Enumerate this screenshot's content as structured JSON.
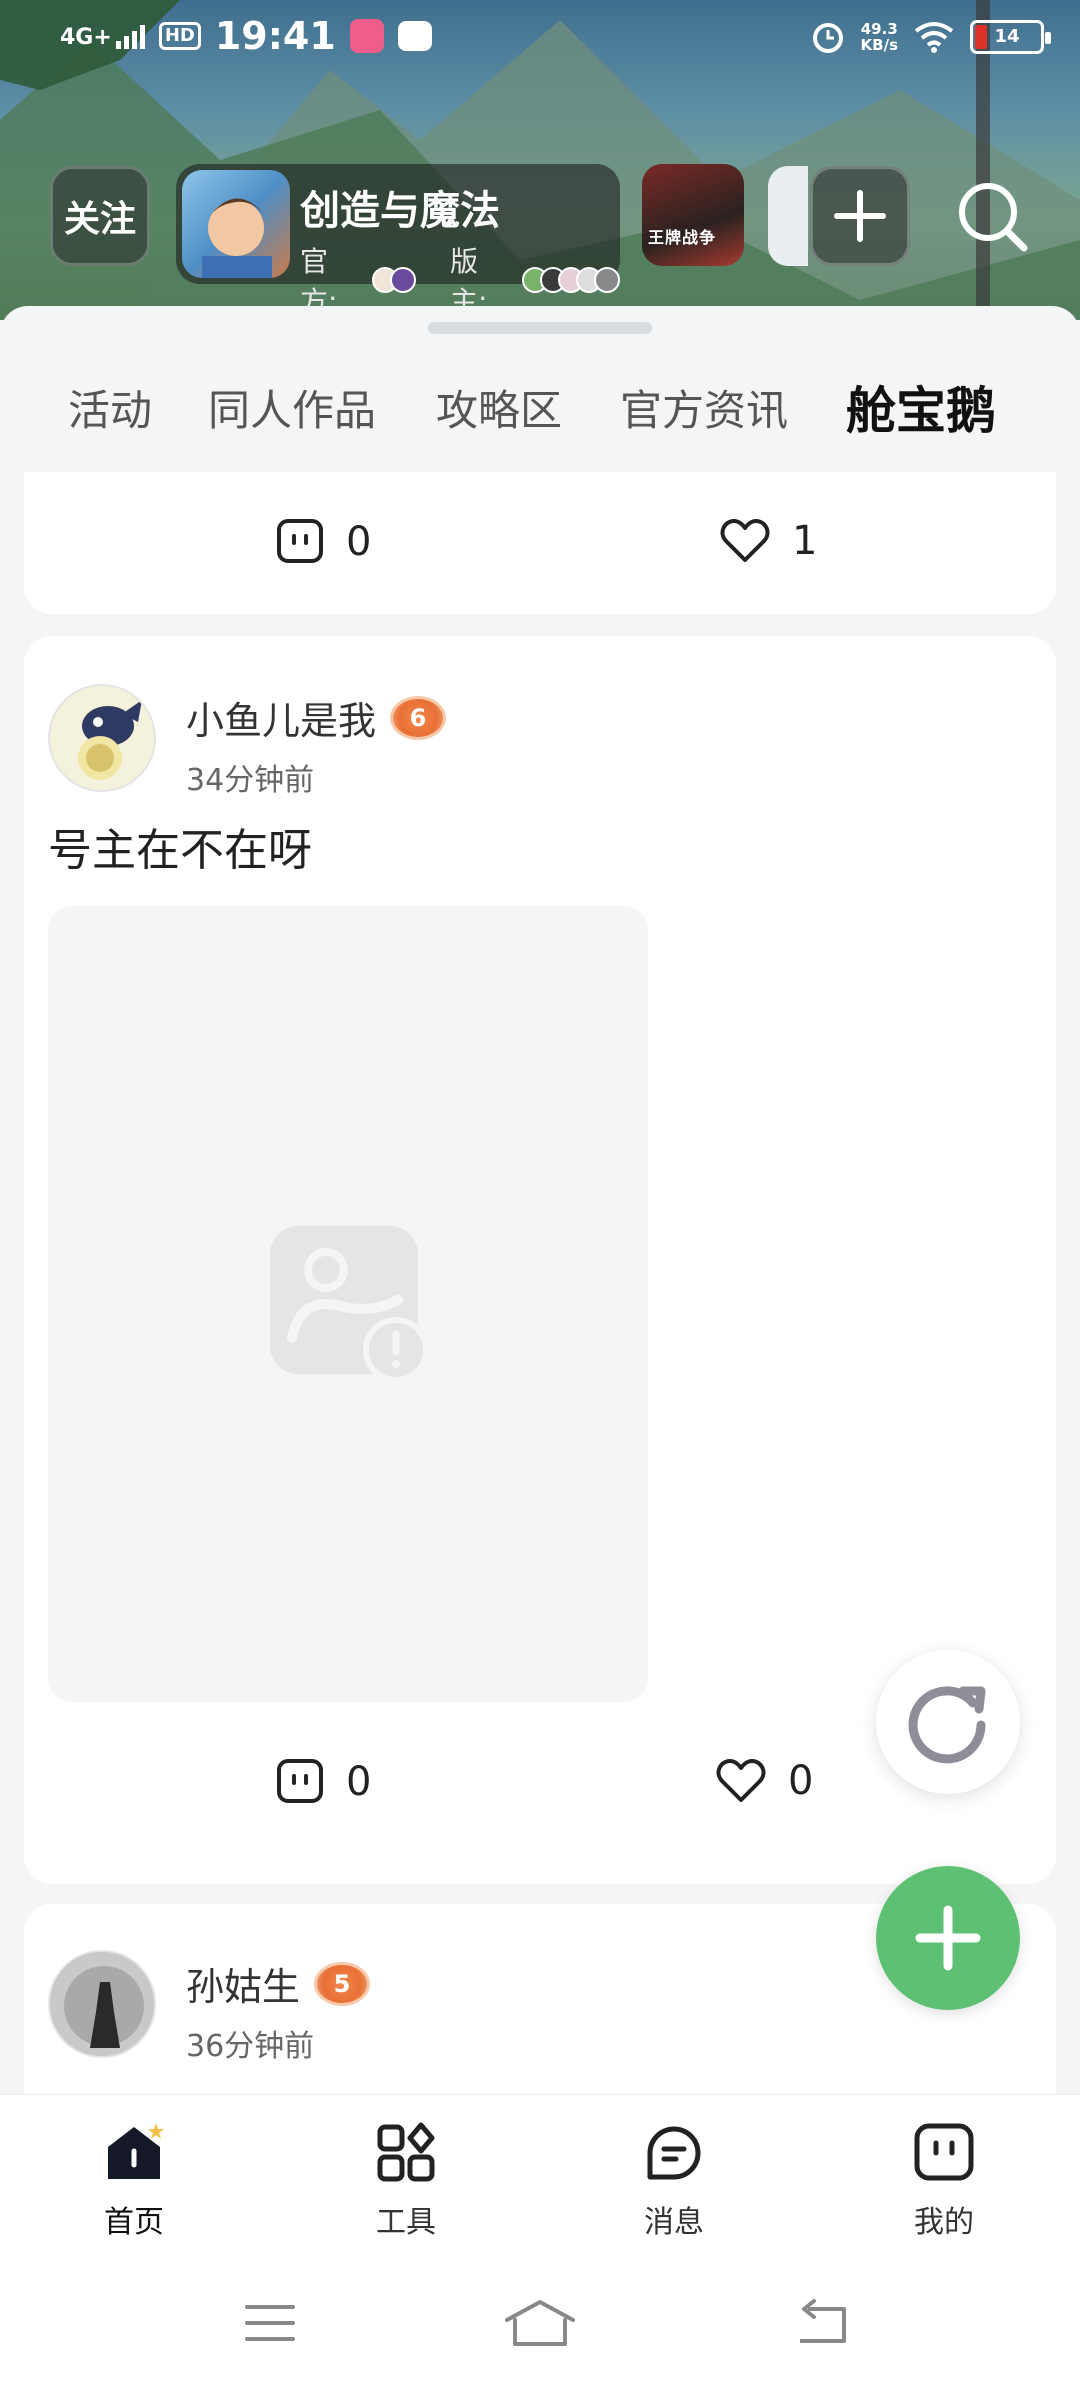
{
  "status_bar": {
    "network": "4G+",
    "hd": "HD",
    "time": "19:41",
    "speed_value": "49.3",
    "speed_unit": "KB/s",
    "battery": "14"
  },
  "header": {
    "follow_label": "关注",
    "game": {
      "title": "创造与魔法",
      "official_label": "官方:",
      "moderator_label": "版主:"
    },
    "other_game_label": "王牌战争"
  },
  "tabs": [
    {
      "label": "活动",
      "active": false
    },
    {
      "label": "同人作品",
      "active": false
    },
    {
      "label": "攻略区",
      "active": false
    },
    {
      "label": "官方资讯",
      "active": false
    },
    {
      "label": "舱宝鹅",
      "active": true
    }
  ],
  "feed": {
    "prev_card": {
      "comments": "0",
      "likes": "1"
    },
    "posts": [
      {
        "author": "小鱼儿是我",
        "level": "6",
        "time": "34分钟前",
        "text": "号主在不在呀",
        "comments": "0",
        "likes": "0"
      },
      {
        "author": "孙姑生",
        "level": "5",
        "time": "36分钟前"
      }
    ]
  },
  "bottom_nav": [
    {
      "label": "首页",
      "icon": "home-icon",
      "active": true
    },
    {
      "label": "工具",
      "icon": "tools-icon",
      "active": false
    },
    {
      "label": "消息",
      "icon": "message-icon",
      "active": false
    },
    {
      "label": "我的",
      "icon": "profile-icon",
      "active": false
    }
  ],
  "colors": {
    "accent_green": "#5ec072",
    "tab_highlight": "#5ed67e",
    "level_badge": "#e96f35"
  }
}
